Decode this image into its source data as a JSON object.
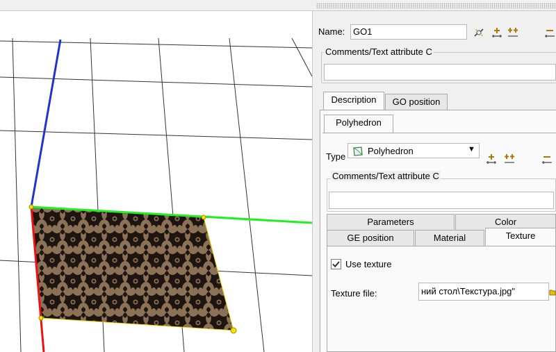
{
  "name_label": "Name:",
  "name_value": "GO1",
  "comments_title_1": "Comments/Text attribute C",
  "comments_value_1": "",
  "outer_tabs": [
    {
      "label": "Description",
      "active": true
    },
    {
      "label": "GO position",
      "active": false
    }
  ],
  "inner_tab": "Polyhedron",
  "type_label": "Type",
  "type_value": "Polyhedron",
  "comments_title_2": "Comments/Text attribute C",
  "comments_value_2": "",
  "prop_tabs_row1": [
    {
      "label": "Parameters"
    },
    {
      "label": "Color"
    }
  ],
  "prop_tabs_row2": [
    {
      "label": "GE position"
    },
    {
      "label": "Material"
    },
    {
      "label": "Texture",
      "active": true
    }
  ],
  "use_texture_label": "Use texture",
  "use_texture_checked": true,
  "texture_file_label": "Texture file:",
  "texture_file_value": "ний стол\\Текстура.jpg\"",
  "icons": [
    "link-icon",
    "add-child-icon",
    "add-sibling-icon",
    "move-down-icon"
  ],
  "colors": {
    "x_axis": "#22ee22",
    "y_axis": "#2233cc",
    "z_axis": "#ee1111",
    "grid": "#333333",
    "texture_base": "#8b7256",
    "vertex": "#f2e600"
  }
}
